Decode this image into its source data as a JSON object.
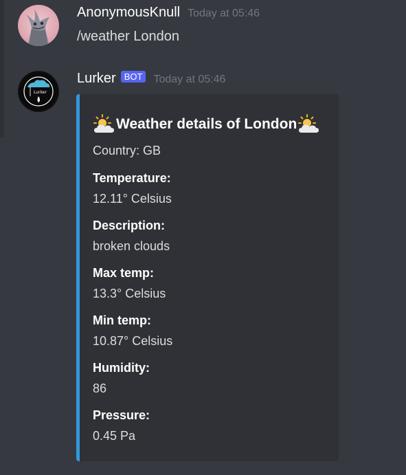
{
  "messages": [
    {
      "username": "AnonymousKnull",
      "timestamp": "Today at 05:46",
      "text": "/weather London"
    },
    {
      "username": "Lurker",
      "bot_tag": "BOT",
      "timestamp": "Today at 05:46",
      "bot_avatar_label": "Lurker"
    }
  ],
  "embed": {
    "accent_color": "#3498db",
    "title": "Weather details of London",
    "title_icon": "sun-behind-cloud-emoji",
    "country_line": "Country: GB",
    "fields": [
      {
        "name": "Temperature:",
        "value": "12.11° Celsius"
      },
      {
        "name": "Description:",
        "value": "broken clouds"
      },
      {
        "name": "Max temp:",
        "value": "13.3° Celsius"
      },
      {
        "name": "Min temp:",
        "value": "10.87° Celsius"
      },
      {
        "name": "Humidity:",
        "value": "86"
      },
      {
        "name": "Pressure:",
        "value": "0.45 Pa"
      }
    ]
  }
}
